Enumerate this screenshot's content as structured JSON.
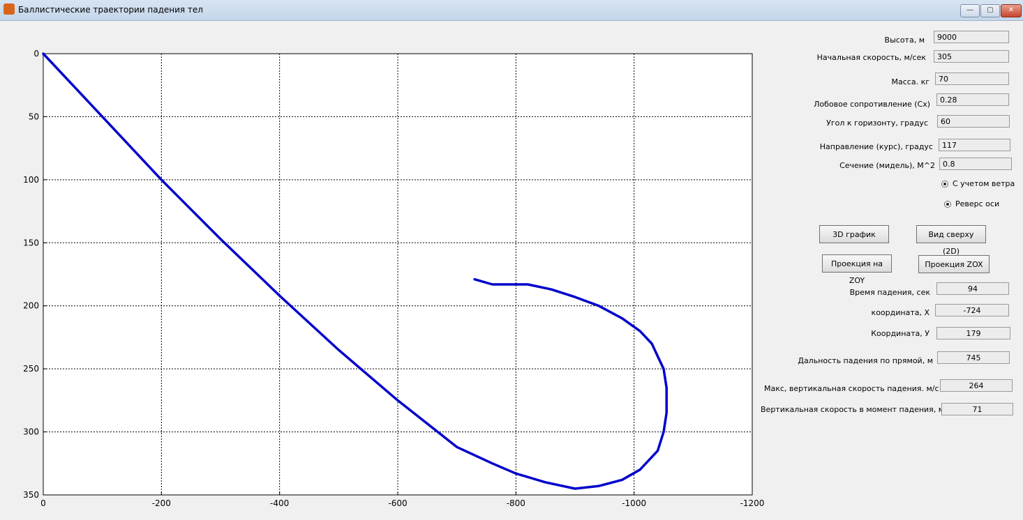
{
  "window": {
    "title": "Баллистические траектории падения тел",
    "minimize_icon": "minimize-icon",
    "maximize_icon": "maximize-icon",
    "close_icon": "close-icon"
  },
  "inputs": {
    "height": {
      "label": "Высота, м",
      "value": "9000"
    },
    "initial_speed": {
      "label": "Начальная скорость, м/сек",
      "value": "305"
    },
    "mass": {
      "label": "Масса. кг",
      "value": "70"
    },
    "drag": {
      "label": "Лобовое сопротивление (Сх)",
      "value": "0.28"
    },
    "angle": {
      "label": "Угол к горизонту, градус",
      "value": "60"
    },
    "course": {
      "label": "Направление  (курс), градус",
      "value": "117"
    },
    "section": {
      "label": "Сечение (мидель), М^2",
      "value": "0.8"
    }
  },
  "options": {
    "wind": {
      "label": "С учетом ветра",
      "checked": true
    },
    "reverse": {
      "label": "Реверс оси",
      "checked": true
    }
  },
  "buttons": {
    "plot3d": "3D график",
    "top_view": "Вид сверху (2D)",
    "proj_zoy": "Проекция на ZOY",
    "proj_zox": "Проекция ZOX"
  },
  "results": {
    "fall_time": {
      "label": "Время падения, сек",
      "value": "94"
    },
    "coord_x": {
      "label": "координата, X",
      "value": "-724"
    },
    "coord_y": {
      "label": "Координата, У",
      "value": "179"
    },
    "range": {
      "label": "Дальность падения по прямой, м",
      "value": "745"
    },
    "max_vspeed": {
      "label": "Макс,  вертикальная скорость падения. м/с",
      "value": "264"
    },
    "impact_vspeed": {
      "label": "Вертикальная  скорость в момент падения, м/с",
      "value": "71"
    }
  },
  "chart_data": {
    "type": "line",
    "title": "",
    "xlabel": "",
    "ylabel": "",
    "xlim": [
      0,
      -1200
    ],
    "ylim": [
      0,
      350
    ],
    "y_reversed": true,
    "grid": true,
    "x_ticks": [
      "0",
      "-200",
      "-400",
      "-600",
      "-800",
      "-1000",
      "-1200"
    ],
    "y_ticks": [
      "0",
      "50",
      "100",
      "150",
      "200",
      "250",
      "300",
      "350"
    ],
    "line_color": "#0000cc",
    "series": [
      {
        "x": [
          0,
          -100,
          -200,
          -300,
          -400,
          -500,
          -600,
          -700,
          -760,
          -800,
          -850,
          -900,
          -940,
          -980,
          -1010,
          -1040,
          -1050,
          -1055,
          -1055,
          -1050,
          -1040,
          -1030,
          -1010,
          -980,
          -940,
          -900,
          -860,
          -820,
          -790,
          -760,
          -730
        ],
        "y": [
          0,
          50,
          100,
          147,
          192,
          235,
          275,
          312,
          325,
          333,
          340,
          345,
          343,
          338,
          330,
          315,
          300,
          285,
          265,
          250,
          240,
          230,
          220,
          210,
          200,
          193,
          187,
          183,
          183,
          183,
          179
        ]
      }
    ]
  }
}
